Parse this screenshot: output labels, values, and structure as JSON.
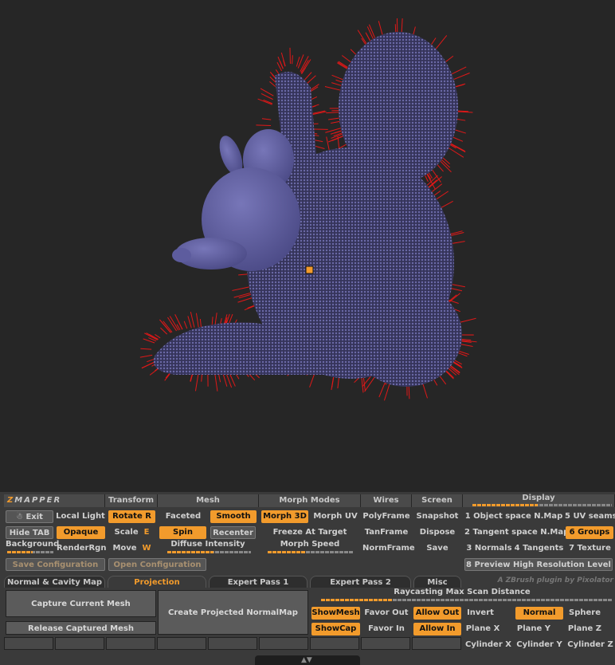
{
  "logo": {
    "first": "Z",
    "rest": "MAPPER"
  },
  "sections": {
    "transform": "Transform",
    "mesh": "Mesh",
    "morph_modes": "Morph Modes",
    "wires": "Wires",
    "screen": "Screen",
    "display": "Display"
  },
  "buttons": {
    "exit": "Exit",
    "local_light": "Local Light",
    "hide_tab": "Hide TAB",
    "opaque": "Opaque",
    "background": "Background",
    "render_rgn": "RenderRgn",
    "rotate": "Rotate",
    "rotate_key": "R",
    "scale": "Scale",
    "scale_key": "E",
    "move": "Move",
    "move_key": "W",
    "faceted": "Faceted",
    "smooth": "Smooth",
    "spin": "Spin",
    "recenter": "Recenter",
    "diffuse_intensity": "Diffuse Intensity",
    "morph_3d": "Morph 3D",
    "morph_uv": "Morph UV",
    "freeze_at_target": "Freeze At Target",
    "morph_speed": "Morph Speed",
    "polyframe": "PolyFrame",
    "tanframe": "TanFrame",
    "normframe": "NormFrame",
    "snapshot": "Snapshot",
    "dispose": "Dispose",
    "save": "Save",
    "save_configuration": "Save Configuration",
    "open_configuration": "Open Configuration",
    "preview_high_res": "8 Preview High Resolution Level"
  },
  "display_items": {
    "object_space": "1 Object space N.Map",
    "uv_seams": "5 UV seams",
    "tangent_space": "2 Tangent space N.Map",
    "groups": "6 Groups",
    "normals": "3 Normals",
    "tangents": "4 Tangents",
    "texture": "7 Texture"
  },
  "tabs": [
    "Normal & Cavity Map",
    "Projection",
    "Expert Pass 1",
    "Expert Pass 2",
    "Misc"
  ],
  "plugin_credit": "A ZBrush plugin by Pixolator",
  "projection": {
    "capture": "Capture Current Mesh",
    "release": "Release Captured Mesh",
    "create": "Create Projected NormalMap",
    "raycasting": "Raycasting Max Scan Distance",
    "show_mesh": "ShowMesh",
    "show_cap": "ShowCap",
    "favor_out": "Favor Out",
    "favor_in": "Favor In",
    "allow_out": "Allow Out",
    "allow_in": "Allow In",
    "invert": "Invert",
    "normal": "Normal",
    "sphere": "Sphere",
    "plane_x": "Plane X",
    "plane_y": "Plane Y",
    "plane_z": "Plane Z",
    "cyl_x": "Cylinder X",
    "cyl_y": "Cylinder Y",
    "cyl_z": "Cylinder Z"
  },
  "levels": {
    "background": 0.55,
    "diffuse_intensity": 0.55,
    "morph_speed": 0.45,
    "display": 0.5,
    "raycasting": 0.25
  },
  "colors": {
    "accent": "#f29b2c",
    "mesh": "#6b6aa8",
    "normals": "#e01818"
  }
}
